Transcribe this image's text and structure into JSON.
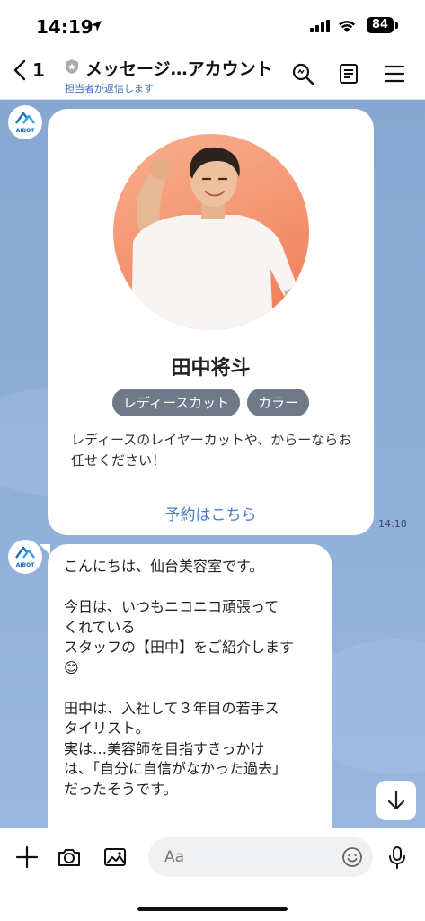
{
  "status_bar": {
    "time": "14:19",
    "battery": "84"
  },
  "header": {
    "back_count": "1",
    "title": "メッセージ…アカウント",
    "subtitle": "担当者が返信します",
    "icons": [
      "search-icon",
      "notes-icon",
      "menu-icon"
    ]
  },
  "card": {
    "name": "田中将斗",
    "tags": [
      "レディースカット",
      "カラー"
    ],
    "description": "レディースのレイヤーカットや、からーならお任せください！",
    "link": "予約はこちら",
    "timestamp": "14:18"
  },
  "avatar": {
    "label": "AIBOT"
  },
  "message": {
    "paragraphs": [
      "こんにちは、仙台美容室です。",
      "今日は、いつもニコニコ頑張って\nくれている\nスタッフの【田中】をご紹介します\n😊",
      "田中は、入社して３年目の若手ス\nタイリスト。\n実は…美容師を目指すきっかけ\nは、「自分に自信がなかった過去」\nだったそうです。"
    ]
  },
  "input": {
    "placeholder": "Aa"
  },
  "colors": {
    "chat_bg": "#8eaed8",
    "accent": "#4b7ac7",
    "tag_bg": "#6f7987"
  }
}
